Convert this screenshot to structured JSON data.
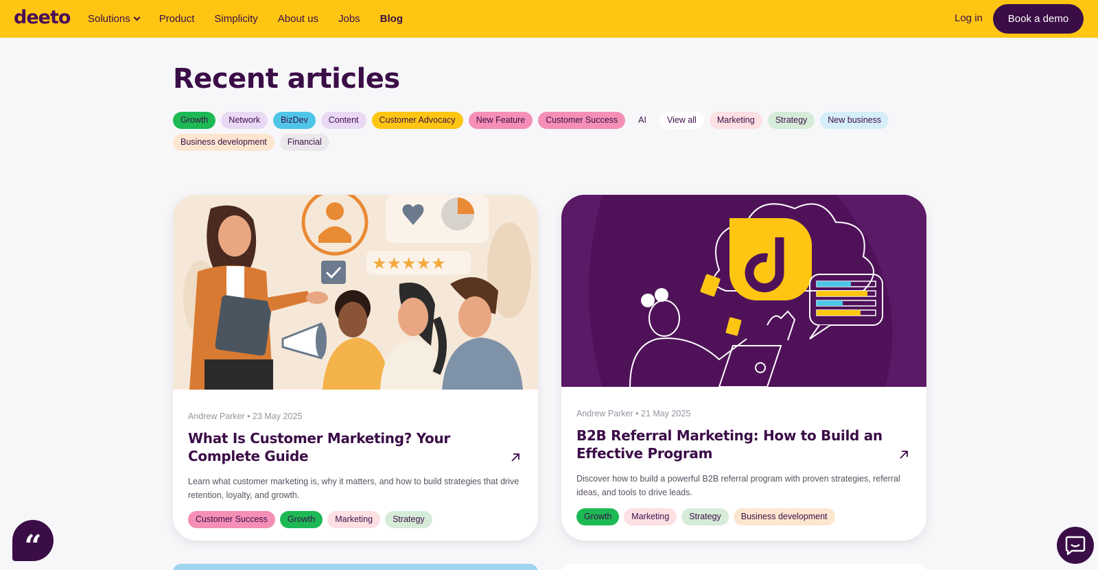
{
  "nav": {
    "logo": "deeto",
    "links": [
      {
        "label": "Solutions",
        "dropdown": true
      },
      {
        "label": "Product"
      },
      {
        "label": "Simplicity"
      },
      {
        "label": "About us"
      },
      {
        "label": "Jobs"
      },
      {
        "label": "Blog",
        "active": true
      }
    ],
    "login_label": "Log in",
    "demo_label": "Book a demo"
  },
  "page": {
    "title": "Recent articles"
  },
  "filters": [
    {
      "label": "Growth",
      "bg": "#1db954",
      "color": "#3b0d47"
    },
    {
      "label": "Network",
      "bg": "#ead9f5",
      "color": "#3b0d47"
    },
    {
      "label": "BizDev",
      "bg": "#4fc6e8",
      "color": "#3b0d47"
    },
    {
      "label": "Content",
      "bg": "#ead9f5",
      "color": "#3b0d47"
    },
    {
      "label": "Customer Advocacy",
      "bg": "#fec613",
      "color": "#3b0d47"
    },
    {
      "label": "New Feature",
      "bg": "#f58fb6",
      "color": "#3b0d47"
    },
    {
      "label": "Customer Success",
      "bg": "#f58fb6",
      "color": "#3b0d47"
    },
    {
      "label": "AI",
      "bg": "transparent",
      "color": "#3b0d47"
    },
    {
      "label": "View all",
      "bg": "#ffffff",
      "color": "#3b0d47"
    },
    {
      "label": "Marketing",
      "bg": "#fde0e3",
      "color": "#3b0d47"
    },
    {
      "label": "Strategy",
      "bg": "#d6ecd9",
      "color": "#3b0d47"
    },
    {
      "label": "New business",
      "bg": "#d5eef8",
      "color": "#3b0d47"
    },
    {
      "label": "Business development",
      "bg": "#fde6cf",
      "color": "#3b0d47"
    },
    {
      "label": "Financial",
      "bg": "#ebe8ec",
      "color": "#3b0d47"
    }
  ],
  "articles": [
    {
      "meta": "Andrew Parker • 23 May 2025",
      "title": "What Is Customer Marketing? Your Complete Guide",
      "excerpt": "Learn what customer marketing is, why it matters, and how to build strategies that drive retention, loyalty, and growth.",
      "tags": [
        {
          "label": "Customer Success",
          "bg": "#f58fb6"
        },
        {
          "label": "Growth",
          "bg": "#1db954"
        },
        {
          "label": "Marketing",
          "bg": "#fde0e3"
        },
        {
          "label": "Strategy",
          "bg": "#d6ecd9"
        }
      ]
    },
    {
      "meta": "Andrew Parker • 21 May 2025",
      "title": "B2B Referral Marketing: How to Build an Effective Program",
      "excerpt": "Discover how to build a powerful B2B referral program with proven strategies, referral ideas, and tools to drive leads.",
      "tags": [
        {
          "label": "Growth",
          "bg": "#1db954"
        },
        {
          "label": "Marketing",
          "bg": "#fde0e3"
        },
        {
          "label": "Strategy",
          "bg": "#d6ecd9"
        },
        {
          "label": "Business development",
          "bg": "#fde6cf"
        }
      ]
    }
  ],
  "floating": {
    "quote_glyph": "“"
  },
  "colors": {
    "brand_yellow": "#fec613",
    "brand_purple": "#3b0d47",
    "card2_bg": "#4f1259"
  }
}
